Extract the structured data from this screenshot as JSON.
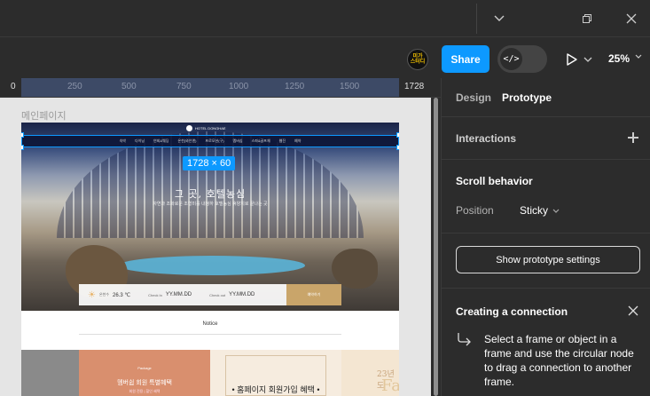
{
  "toolbar": {
    "avatar_text": "미가 스터디",
    "share_label": "Share",
    "dev_mode_icon": "</>",
    "zoom": "25%"
  },
  "ruler": {
    "ticks": [
      "0",
      "250",
      "500",
      "750",
      "1000",
      "1250",
      "1500",
      "1728"
    ]
  },
  "canvas": {
    "frame_label": "메인페이지",
    "dimension_badge": "1728 × 60",
    "logo": "HOTEL DONGHAE",
    "nav": [
      "숙박",
      "다이닝",
      "연회&웨딩",
      "온천(와인앤)",
      "프로모션(구)",
      "멤버십",
      "스파&골프체",
      "웹진",
      "예약"
    ],
    "hero_title": "그 곳, 호텔농심",
    "hero_subtitle": "자연과 조화로운 조형미를 내정하 호텔농심 휴양지로 끝나는 곳",
    "booking": {
      "temp_label": "온천수",
      "temp_value": "26.3 ℃",
      "checkin_label": "Check In",
      "checkin_value": "YY.MM.DD",
      "checkout_label": "Check out",
      "checkout_value": "YY.MM.DD",
      "button": "예약하기"
    },
    "notice": "Notice",
    "card2": {
      "kicker": "Package",
      "title": "멤버쉽 회원 특별혜택",
      "sub": "회원 전용 | 할인 혜택"
    },
    "card3_title": "• 홈페이지 회원가입 혜택 •",
    "card4": {
      "date": "23년 도",
      "letter": "Fa"
    }
  },
  "panel": {
    "tabs": [
      "Design",
      "Prototype"
    ],
    "interactions": "Interactions",
    "scroll_behavior": "Scroll behavior",
    "position_label": "Position",
    "position_value": "Sticky",
    "settings_button": "Show prototype settings",
    "connection_title": "Creating a connection",
    "connection_text": "Select a frame or object in a frame and use the circular node to drag a connection to another frame."
  }
}
